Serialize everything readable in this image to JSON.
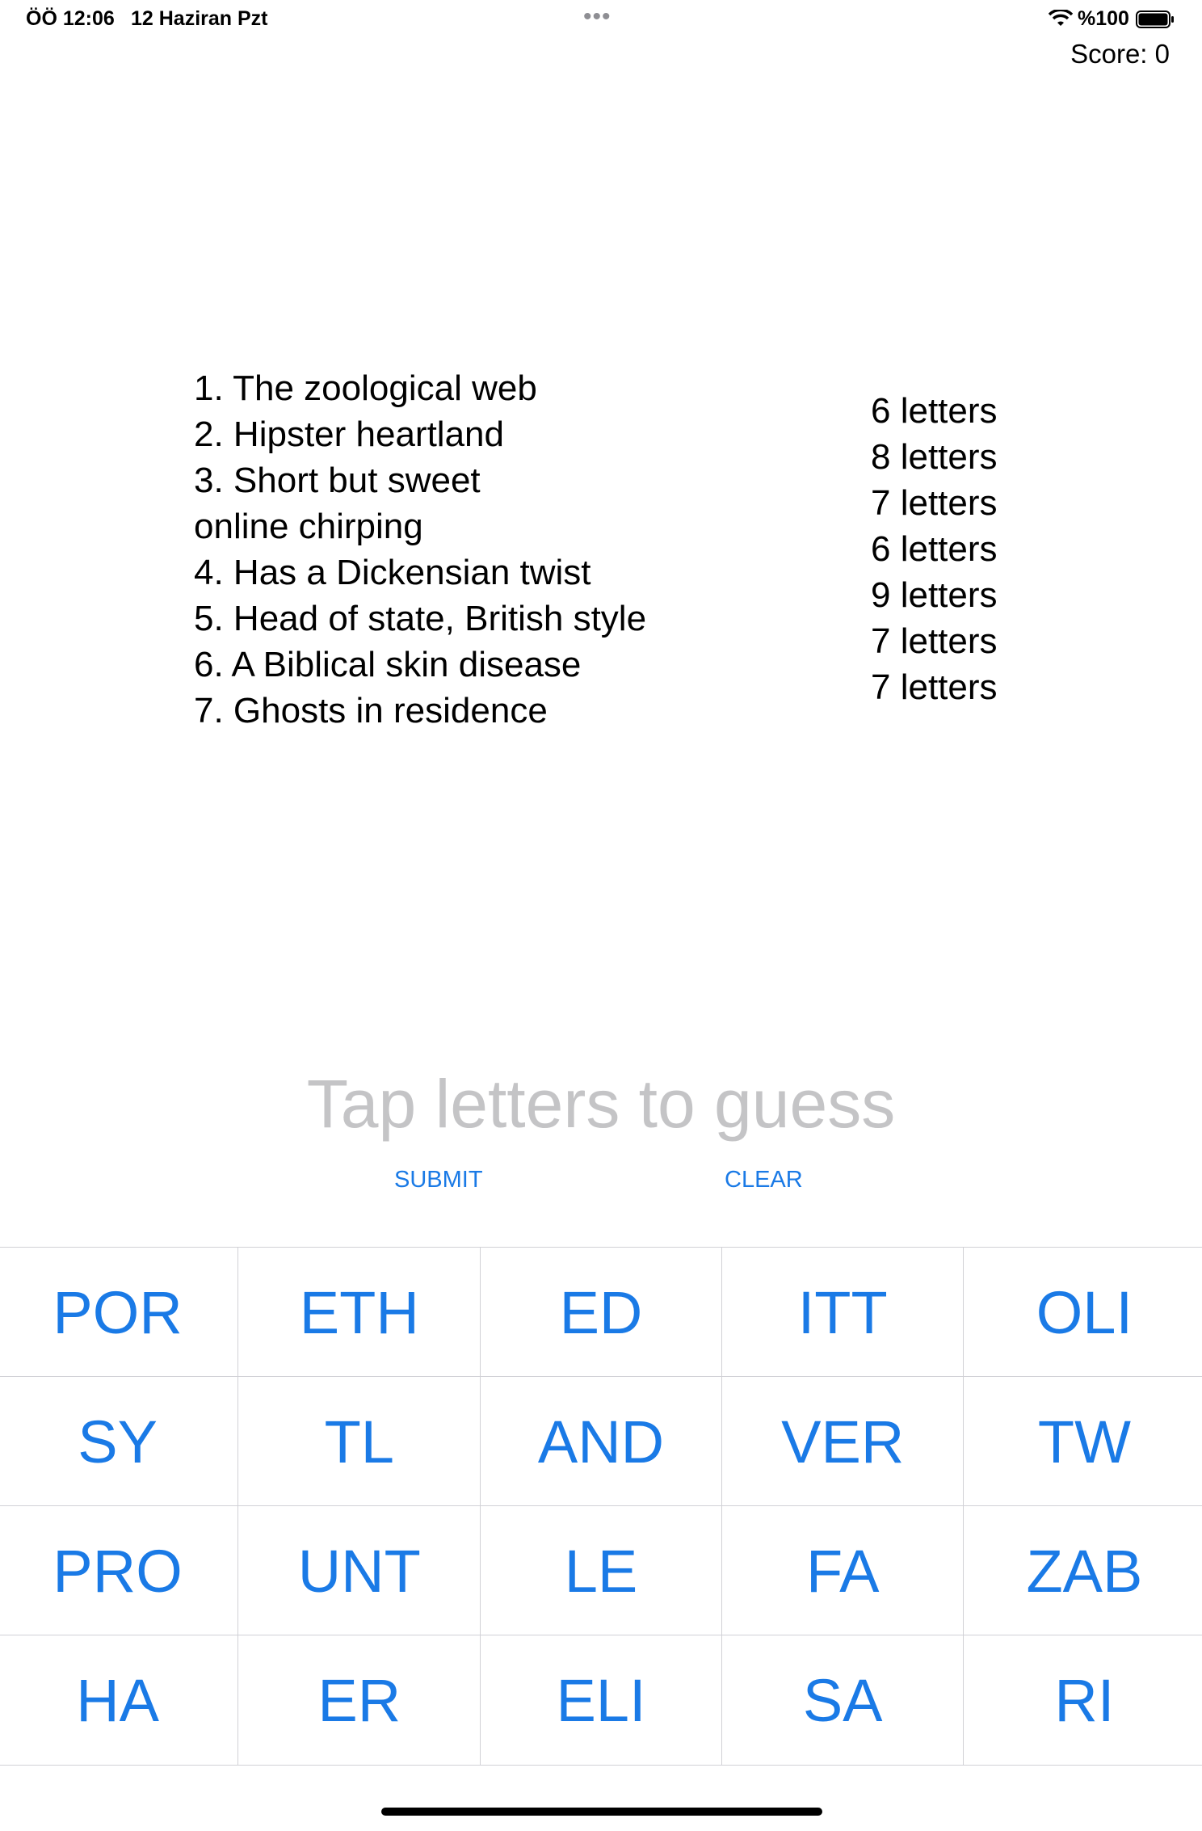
{
  "status_bar": {
    "time": "ÖÖ 12:06",
    "date": "12 Haziran Pzt",
    "battery_percent": "%100",
    "icons": [
      "wifi-icon",
      "battery-icon"
    ]
  },
  "score_label": "Score: 0",
  "clues": [
    "1. The zoological web",
    "2. Hipster heartland",
    "3. Short but sweet\nonline chirping",
    "4. Has a Dickensian twist",
    "5. Head of state, British style",
    "6. A Biblical skin disease",
    "7. Ghosts in residence"
  ],
  "lengths": [
    "6 letters",
    "8 letters",
    "7 letters",
    "6 letters",
    "9 letters",
    "7 letters",
    "7 letters"
  ],
  "guess_placeholder": "Tap letters to guess",
  "actions": {
    "submit": "SUBMIT",
    "clear": "CLEAR"
  },
  "tiles": [
    "POR",
    "ETH",
    "ED",
    "ITT",
    "OLI",
    "SY",
    "TL",
    "AND",
    "VER",
    "TW",
    "PRO",
    "UNT",
    "LE",
    "FA",
    "ZAB",
    "HA",
    "ER",
    "ELI",
    "SA",
    "RI"
  ],
  "colors": {
    "accent": "#1a7ae6",
    "placeholder": "#c4c4c6",
    "tile_border": "#d1d1d6"
  }
}
